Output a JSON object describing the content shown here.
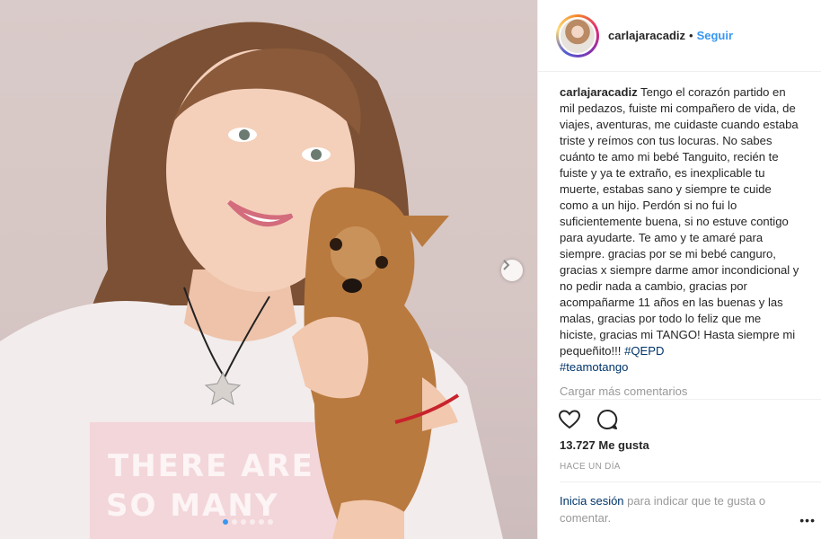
{
  "post": {
    "shirt_text": "THERE ARE SO MANY BEAUTIFUL"
  },
  "header": {
    "username": "carlajaracadiz",
    "separator": "•",
    "follow_label": "Seguir"
  },
  "caption": {
    "username": "carlajaracadiz",
    "text": " Tengo el corazón partido en mil pedazos, fuiste mi compañero de vida, de viajes, aventuras, me cuidaste cuando estaba triste y reímos con tus locuras. No sabes cuánto te amo mi bebé Tanguito, recién te fuiste y ya te extraño, es inexplicable tu muerte, estabas sano y siempre te cuide como a un hijo. Perdón si no fui lo suficientemente buena, si no estuve contigo para ayudarte. Te amo y te amaré para siempre. gracias por se mi bebé canguro, gracias x siempre darme amor incondicional y no pedir nada a cambio, gracias por acompañarme 11 años en las buenas y las malas, gracias por todo lo feliz que me hiciste, gracias mi TANGO! Hasta siempre mi pequeñito!!! ",
    "hashtag1": "#QEPD",
    "hashtag2": "#teamotango"
  },
  "comments": {
    "load_more": "Cargar más comentarios"
  },
  "stats": {
    "likes": "13.727 Me gusta",
    "time": "HACE UN DÍA"
  },
  "login_prompt": {
    "link": "Inicia sesión",
    "text": " para indicar que te gusta o comentar."
  },
  "more_menu": "•••",
  "colors": {
    "accent": "#3897f0",
    "hashtag": "#003569",
    "muted": "#999999"
  }
}
